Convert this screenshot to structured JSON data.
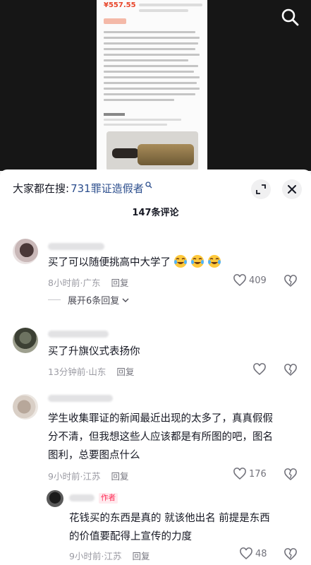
{
  "video": {
    "price": "¥557.55"
  },
  "panel": {
    "search_prefix": "大家都在搜:",
    "search_term": "731罪证造假者",
    "comment_count": "147条评论"
  },
  "comments": [
    {
      "text": "买了可以随便挑高中大学了",
      "time": "8小时前",
      "location": "广东",
      "reply": "回复",
      "likes": "409",
      "expand": "展开6条回复"
    },
    {
      "text": "买了升旗仪式表扬你",
      "time": "13分钟前",
      "location": "山东",
      "reply": "回复",
      "likes": ""
    },
    {
      "lines": [
        "学生收集罪证的新闻最近出现的太多了，真真假假",
        "分不清，但我想这些人应该都是有所图的吧，图名",
        "图利，总要图点什么"
      ],
      "time": "9小时前",
      "location": "江苏",
      "reply": "回复",
      "likes": "176"
    }
  ],
  "author_reply": {
    "badge": "作者",
    "lines": [
      "花钱买的东西是真的 就该他出名 前提是东西",
      "的价值要配得上宣传的力度"
    ],
    "time": "9小时前",
    "location": "江苏",
    "reply": "回复",
    "likes": "48"
  },
  "icons": {
    "search": "search-icon",
    "expand": "expand-icon",
    "close": "close-icon",
    "like": "heart-icon",
    "dislike": "broken-heart-icon",
    "emoji": "laughing-tears-emoji"
  },
  "colors": {
    "accent_red": "#fe2c55",
    "search_term_blue": "#2d4f8e",
    "price_red": "#e8452a"
  }
}
